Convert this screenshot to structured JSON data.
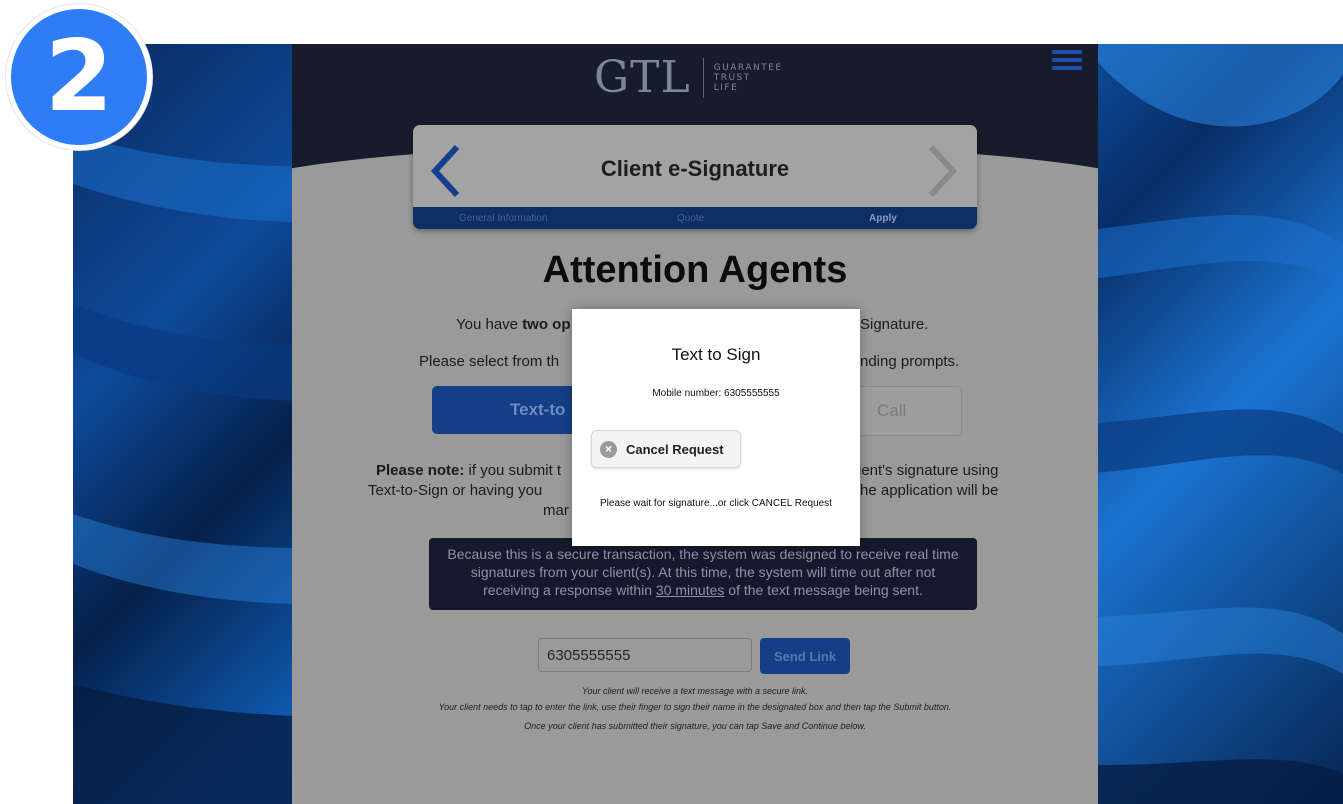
{
  "step_badge": "2",
  "logo": {
    "mark": "GTL",
    "line1": "GUARANTEE",
    "line2": "TRUST",
    "line3": "LIFE"
  },
  "step_card": {
    "title": "Client e-Signature",
    "progress_steps": [
      "General Information",
      "Quote",
      "Apply"
    ],
    "active_step": "Apply"
  },
  "main": {
    "title": "Attention Agents",
    "intro_start": "You have ",
    "intro_bold": "two op",
    "intro_end": "Signature.",
    "select_start": "Please select from th",
    "select_end": "nding prompts.",
    "text_to_sign_button": "Text-to",
    "call_button": "Call",
    "note_bold": "Please note:",
    "note_line1_start": " if you submit t",
    "note_line1_end": "ient's signature using",
    "note_line2_start": "Text-to-Sign or having you",
    "note_line2_end": "he application will be",
    "note_line3": "mar",
    "secure_line1": "Because this is a secure transaction, the system was designed to receive real time",
    "secure_line2": "signatures from your client(s). At this time, the system will time out after not",
    "secure_line3_start": "receiving a response within ",
    "secure_line3_link": "30 minutes",
    "secure_line3_end": " of the text message being sent.",
    "phone_value": "6305555555",
    "send_button": "Send Link",
    "help_line1": "Your client will receive a text message with a secure link.",
    "help_line2": "Your client needs to tap to enter the link, use their finger to sign their name in the designated box and then tap the Submit button.",
    "help_line3": "Once your client has submitted their signature, you can tap Save and Continue below."
  },
  "modal": {
    "title": "Text to Sign",
    "mobile_text": "Mobile number: 6305555555",
    "cancel_button": "Cancel Request",
    "wait_text": "Please wait for signature...or click CANCEL Request"
  },
  "colors": {
    "accent_blue": "#2f7df6",
    "header_navy": "#171c2c",
    "modal_bg": "#ffffff"
  }
}
